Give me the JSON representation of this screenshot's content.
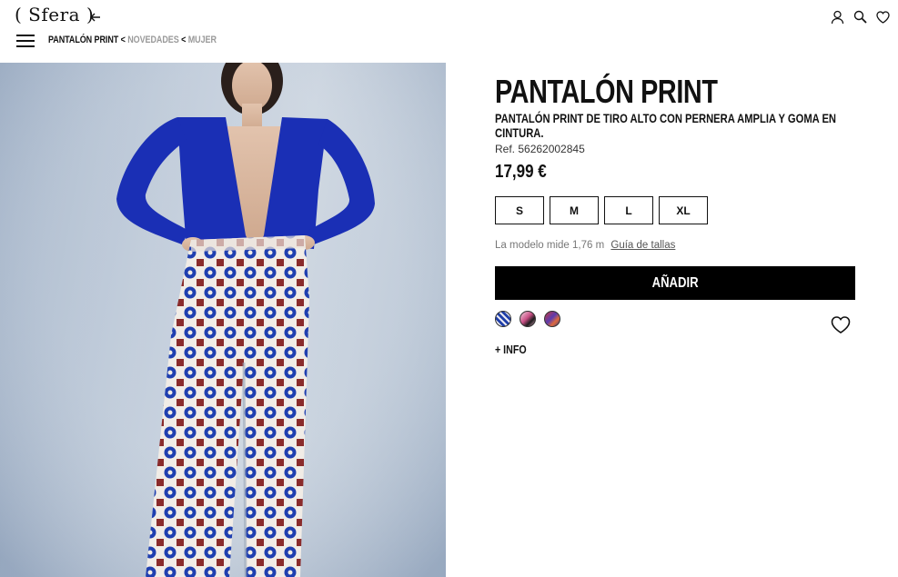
{
  "header": {
    "logo": "( Sfera )",
    "icons": [
      "back-arrow-icon",
      "user-icon",
      "search-icon",
      "heart-icon",
      "menu-icon"
    ]
  },
  "breadcrumb": {
    "current": "PANTALÓN PRINT",
    "separator": "<",
    "items": [
      "NOVEDADES",
      "MUJER"
    ]
  },
  "product": {
    "title": "PANTALÓN PRINT",
    "description": "PANTALÓN PRINT DE TIRO ALTO CON PERNERA AMPLIA Y GOMA EN CINTURA.",
    "ref": "Ref. 56262002845",
    "price": "17,99 €",
    "sizes": [
      "S",
      "M",
      "L",
      "XL"
    ],
    "model_info": "La modelo mide 1,76 m",
    "size_guide": "Guía de tallas",
    "add_button": "AÑADIR",
    "swatches": [
      "blue-print",
      "pink-print",
      "red-print"
    ],
    "more_info": "+ INFO"
  },
  "colors": {
    "cardigan": "#1a2fb5",
    "background": "#b9c6d6",
    "button": "#000000"
  }
}
